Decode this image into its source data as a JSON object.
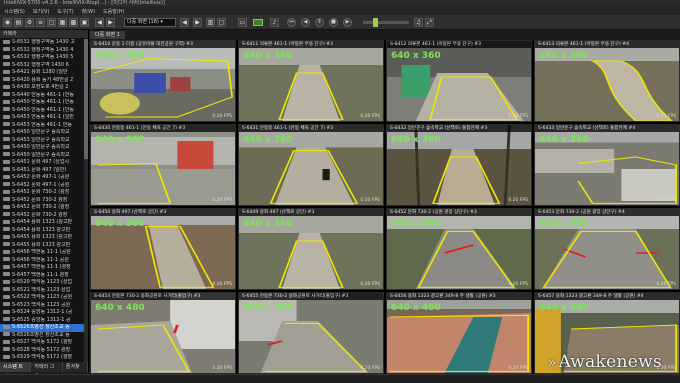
{
  "titlebar": {
    "text": "IntelliVIX-5700 v4.2.6 - IntelliVIX-Rtsp(...) - [미디어 서버(Intellivix)]"
  },
  "menu": [
    "시스템(S)",
    "보기(V)",
    "도구(T)",
    "창(W)",
    "도움말(H)"
  ],
  "toolbar": {
    "layout_value": "다중 화면 (16)",
    "buttons": [
      "camera-icon",
      "folder-icon",
      "settings-icon",
      "list-icon",
      "window-icon",
      "layout-icon",
      "prev-icon",
      "next-icon",
      "mic-icon",
      "skip-back-icon",
      "rewind-icon",
      "pause-icon",
      "stop-icon",
      "fast-forward-icon",
      "skip-forward-icon",
      "volume-icon",
      "fullscreen-icon"
    ]
  },
  "sidebar": {
    "header": "카메라",
    "items": [
      "S-6532 행정구역동 1430 고",
      "S-6532 행정구역동 1430 4",
      "S-6532 행정구역동 1430 5",
      "S-6532 행정구역 1430 6",
      "S-6421 용화 1280 (일반",
      "S-6420 용화 등기 48번길 2",
      "S-6430 포장도로 4번길 2",
      "S-6440 안동동 461-1 (안동",
      "S-6450 안동동 461-1 (안동",
      "S-6450 안동동 461-1 (안동",
      "S-6453 안동동 461-1 (일반",
      "S-6453 안동동 461-1 안동",
      "S-6450 일반문구 숲속학교",
      "S-6453 일반문구 숲속학교",
      "S-6450 일반문구 숲속학교",
      "S-6450 일반문구 숲속학교",
      "S-6451 문화 497 (상업시",
      "S-6451 문화 497 (일반)",
      "S-6452 문화 497-1 (공원",
      "S-6452 문화 497-1 (공원",
      "S-6452 문화 730-2 (광장",
      "S-6452 문화 730-2 광장",
      "S-6452 문화 730-2 (광장",
      "S-6452 문화 730-2 광장",
      "S-6454 용화 1323 (광고판",
      "S-6454 용화 1323 광고판",
      "S-6455 용화 1323 (광고판",
      "S-6455 용화 1323 광고판",
      "S-6456 백현동 11-1 (공원",
      "S-6456 백현동 11-1 공원",
      "S-6457 백현동 11-1 (광장",
      "S-6457 백현동 11-1 광장",
      "S-6520 백석동 1123 (상업",
      "S-6521 백석동 1123 상업",
      "S-6522 백석동 1123 (공원",
      "S-6523 백석동 1123 공원",
      "S-6524 중앙동 1312-1 (공",
      "S-6525 중앙동 1312-1 공",
      "S-6526조병선 창산초교 동",
      "S-6526조병선 창산초교 동",
      "S-6527 백석동 5172 (광장",
      "S-6528 백석동 5172 광장",
      "S-6529 백석동 5172 (광장",
      "S-6530 백석동 1099(학교",
      "S-6531 백석동 1099 학교",
      "S-6531 백석동 1099(학교"
    ],
    "selected_index": 38,
    "tabs": [
      "시스템 트리",
      "카메라 그룹",
      "즐겨찾기"
    ]
  },
  "main_tab": "다중 화면 1",
  "cameras": [
    {
      "title": "S-6410 운동 1 다중 (공유마을 대전공원 구역) #3",
      "res": "640 x 360",
      "fps": "0.20 FPS",
      "scene": "playground"
    },
    {
      "title": "S-6411 의류본 461-1 (아동본 무용 단구) #3",
      "res": "640 x 360",
      "fps": "0.20 FPS",
      "scene": "path"
    },
    {
      "title": "S-6412 의류본 461-1 (아동본 무용 단구) #3",
      "res": "640 x 360",
      "fps": "0.20 FPS",
      "scene": "tunnel"
    },
    {
      "title": "S-6413 의류본 461-1 (아동본 무용 단구) #4",
      "res": "640 x 360",
      "fps": "0.20 FPS",
      "scene": "curve"
    },
    {
      "title": "S-6430 안동동 461-1 (안동 체육 공간 7) #3",
      "res": "640 x 360",
      "fps": "0.20 FPS",
      "scene": "building"
    },
    {
      "title": "S-6431 안동동 461-1 (안동 체육 공간 7) #3",
      "res": "640 x 360",
      "fps": "0.20 FPS",
      "scene": "walker"
    },
    {
      "title": "S-6432 일반문구 숲속학교 (산책로) 통합관제 #3",
      "res": "640 x 360",
      "fps": "0.20 FPS",
      "scene": "forest"
    },
    {
      "title": "S-6433 일반문구 숲속학교 (산책로) 통합관제 #4",
      "res": "640 x 360",
      "fps": "0.20 FPS",
      "scene": "stairs"
    },
    {
      "title": "S-6450 용화 497 (산책로 상단) #3",
      "res": "640 x 360",
      "fps": "0.20 FPS",
      "scene": "slope"
    },
    {
      "title": "S-6449 용화 497 (산책로 상단) #3",
      "res": "640 x 360",
      "fps": "0.20 FPS",
      "scene": "path"
    },
    {
      "title": "S-6452 문화 730-2 (공원 광장 상단구) #3",
      "res": "640 x 360",
      "fps": "0.20 FPS",
      "scene": "road"
    },
    {
      "title": "S-6453 문화 730-2 (공원 광장 상단구) #4",
      "res": "640 x 360",
      "fps": "0.20 FPS",
      "scene": "road2"
    },
    {
      "title": "S-6454 안동본 730-2 용화공원로 사거리(출입구) #3",
      "res": "640 x 480",
      "fps": "0.20 FPS",
      "scene": "alley"
    },
    {
      "title": "S-6455 안동본 730-2 용화공원로 사거리(출입구) #3",
      "res": "640 x 480",
      "fps": "0.20 FPS",
      "scene": "alley2"
    },
    {
      "title": "S-6456 용화 1323 광고판 349-8 주 생활 (공원) #3",
      "res": "640 x 480",
      "fps": "0.20 FPS",
      "scene": "plaza"
    },
    {
      "title": "S-6457 용화 1323 광고판 349-8 주 생활 (공원) #4",
      "res": "640 x 480",
      "fps": "0.20 FPS",
      "scene": "plaza2"
    }
  ],
  "watermark": {
    "chevrons": "»",
    "text": "Awakenews"
  },
  "colors": {
    "roi": "#f2e600",
    "res": "#7fe35a",
    "selected": "#2f6fd1"
  }
}
